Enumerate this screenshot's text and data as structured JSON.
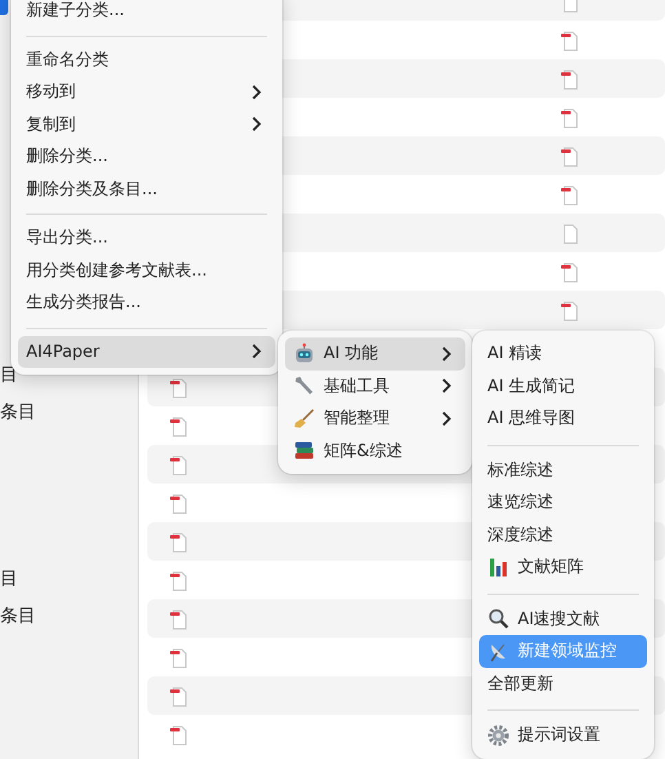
{
  "sidebar": {
    "items": [
      {
        "label": "目"
      },
      {
        "label": "条目"
      },
      {
        "label": "目"
      },
      {
        "label": "条目"
      }
    ]
  },
  "table": {
    "rows": [
      {
        "kind": "file"
      },
      {
        "kind": "pdf"
      },
      {
        "kind": "pdf"
      },
      {
        "kind": "pdf"
      },
      {
        "kind": "pdf"
      },
      {
        "kind": "pdf"
      },
      {
        "kind": "file"
      },
      {
        "kind": "pdf"
      },
      {
        "kind": "pdf"
      },
      {
        "kind": "pdf"
      },
      {
        "kind": "pdf"
      },
      {
        "kind": "pdf"
      },
      {
        "kind": "pdf"
      },
      {
        "kind": "pdf"
      },
      {
        "kind": "pdf"
      },
      {
        "kind": "pdf"
      },
      {
        "kind": "pdf"
      },
      {
        "kind": "pdf"
      },
      {
        "kind": "pdf"
      }
    ]
  },
  "context_menu": {
    "items": [
      {
        "kind": "item",
        "label": "新建子分类...",
        "submenu": false,
        "selected": false
      },
      {
        "kind": "separator"
      },
      {
        "kind": "item",
        "label": "重命名分类",
        "submenu": false,
        "selected": false
      },
      {
        "kind": "item",
        "label": "移动到",
        "submenu": true,
        "selected": false
      },
      {
        "kind": "item",
        "label": "复制到",
        "submenu": true,
        "selected": false
      },
      {
        "kind": "item",
        "label": "删除分类...",
        "submenu": false,
        "selected": false
      },
      {
        "kind": "item",
        "label": "删除分类及条目...",
        "submenu": false,
        "selected": false
      },
      {
        "kind": "separator"
      },
      {
        "kind": "item",
        "label": "导出分类...",
        "submenu": false,
        "selected": false
      },
      {
        "kind": "item",
        "label": "用分类创建参考文献表...",
        "submenu": false,
        "selected": false
      },
      {
        "kind": "item",
        "label": "生成分类报告...",
        "submenu": false,
        "selected": false
      },
      {
        "kind": "separator"
      },
      {
        "kind": "item",
        "label": "AI4Paper",
        "submenu": true,
        "selected": true
      }
    ]
  },
  "submenu": {
    "items": [
      {
        "kind": "item",
        "label": "AI 功能",
        "icon": true,
        "submenu": true,
        "selected": true
      },
      {
        "kind": "item",
        "label": "基础工具",
        "icon": true,
        "submenu": true,
        "selected": false
      },
      {
        "kind": "item",
        "label": "智能整理",
        "icon": true,
        "submenu": true,
        "selected": false
      },
      {
        "kind": "item",
        "label": "矩阵&综述",
        "icon": true,
        "submenu": false,
        "selected": false
      }
    ]
  },
  "ai_submenu": {
    "items": [
      {
        "kind": "item",
        "label": "AI 精读",
        "icon": false,
        "submenu": false,
        "selected": false
      },
      {
        "kind": "item",
        "label": "AI 生成简记",
        "icon": false,
        "submenu": false,
        "selected": false
      },
      {
        "kind": "item",
        "label": "AI 思维导图",
        "icon": false,
        "submenu": false,
        "selected": false
      },
      {
        "kind": "separator"
      },
      {
        "kind": "item",
        "label": "标准综述",
        "icon": false,
        "submenu": false,
        "selected": false
      },
      {
        "kind": "item",
        "label": "速览综述",
        "icon": false,
        "submenu": false,
        "selected": false
      },
      {
        "kind": "item",
        "label": "深度综述",
        "icon": false,
        "submenu": false,
        "selected": false
      },
      {
        "kind": "item",
        "label": "文献矩阵",
        "icon": true,
        "submenu": false,
        "selected": false
      },
      {
        "kind": "separator"
      },
      {
        "kind": "item",
        "label": "AI速搜文献",
        "icon": true,
        "submenu": false,
        "selected": false
      },
      {
        "kind": "item",
        "label": "新建领域监控",
        "icon": true,
        "submenu": false,
        "selected": true
      },
      {
        "kind": "item",
        "label": "全部更新",
        "icon": false,
        "submenu": false,
        "selected": false
      },
      {
        "kind": "separator"
      },
      {
        "kind": "item",
        "label": "提示词设置",
        "icon": true,
        "submenu": false,
        "selected": false
      }
    ]
  }
}
